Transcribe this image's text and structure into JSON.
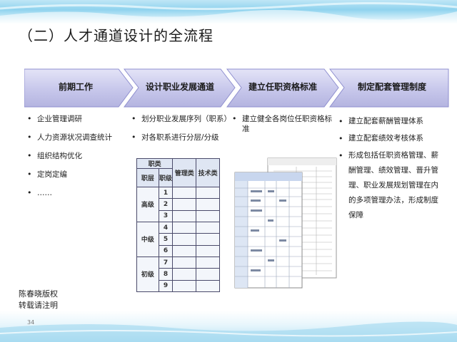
{
  "slide": {
    "title": "（二）人才通道设计的全流程",
    "page_number": "34",
    "copyright": [
      "陈春晓版权",
      "转载请注明"
    ]
  },
  "stages": [
    {
      "label": "前期工作"
    },
    {
      "label": "设计职业发展通道"
    },
    {
      "label": "建立任职资格标准"
    },
    {
      "label": "制定配套管理制度"
    }
  ],
  "columns": {
    "prep": [
      "企业管理调研",
      "人力资源状况调查统计",
      "组织结构优化",
      "定岗定编",
      "……"
    ],
    "career": [
      "划分职业发展序列（职系）",
      "对各职系进行分层/分级"
    ],
    "qualification": [
      "建立健全各岗位任职资格标准"
    ],
    "system": [
      "建立配套薪酬管理体系",
      "建立配套绩效考核体系",
      "形成包括任职资格管理、薪酬管理、绩效管理、晋升管理、职业发展规划管理在内的多项管理办法，形成制度保障"
    ]
  },
  "grade_table": {
    "header_category": "职类",
    "header_level": "职层",
    "header_grade": "职级",
    "col_management": "管理类",
    "col_technical": "技术类",
    "levels": [
      {
        "name": "高级",
        "grades": [
          "1",
          "2",
          "3"
        ]
      },
      {
        "name": "中级",
        "grades": [
          "4",
          "5",
          "6"
        ]
      },
      {
        "name": "初级",
        "grades": [
          "7",
          "8",
          "9"
        ]
      }
    ]
  },
  "colors": {
    "chevron_fill": "#c9c9ec",
    "chevron_stroke": "#7f7fc8",
    "band": "#8fd3ee"
  }
}
